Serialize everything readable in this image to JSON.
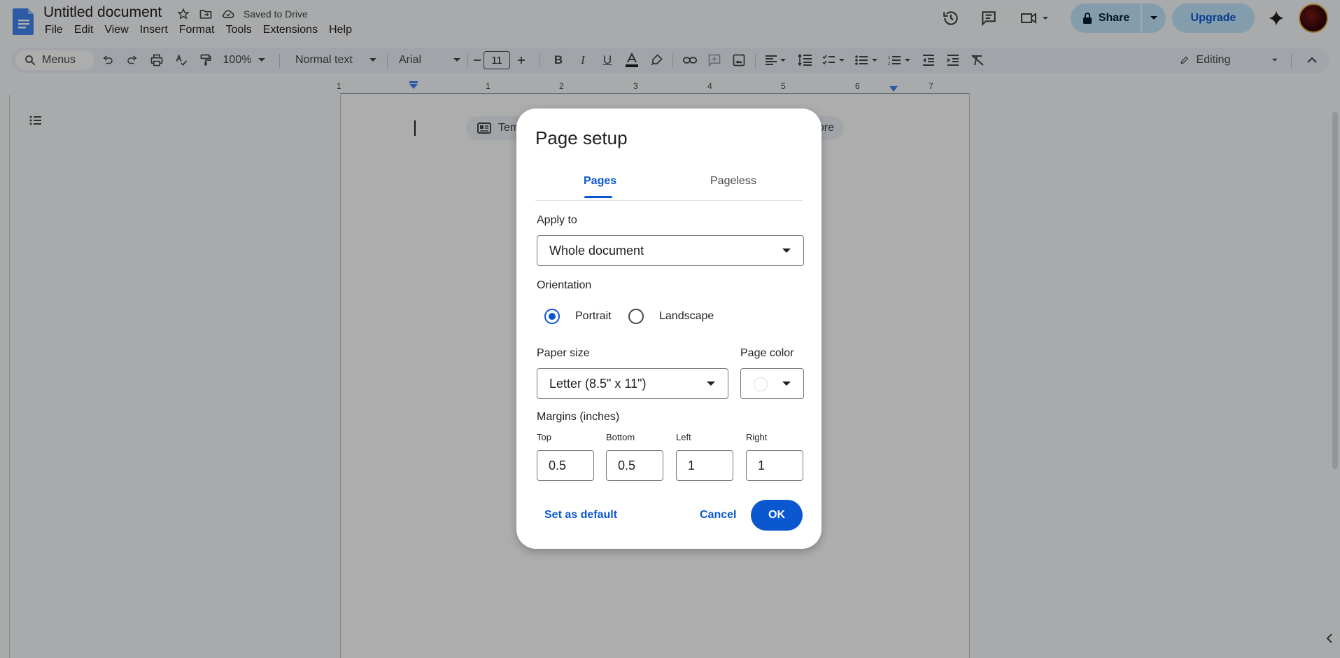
{
  "app": {
    "doc_title": "Untitled document",
    "save_status": "Saved to Drive",
    "menus": [
      "File",
      "Edit",
      "View",
      "Insert",
      "Format",
      "Tools",
      "Extensions",
      "Help"
    ],
    "share_label": "Share",
    "upgrade_label": "Upgrade"
  },
  "toolbar": {
    "search_label": "Menus",
    "zoom": "100%",
    "style": "Normal text",
    "font": "Arial",
    "font_size": "11",
    "mode": "Editing"
  },
  "ruler": {
    "numbers": [
      "1",
      "1",
      "2",
      "3",
      "4",
      "5",
      "6",
      "7"
    ]
  },
  "document": {
    "chip_left_text": "Tem",
    "chip_right_text": "ore"
  },
  "dialog": {
    "title": "Page setup",
    "tabs": [
      {
        "label": "Pages",
        "selected": true
      },
      {
        "label": "Pageless",
        "selected": false
      }
    ],
    "apply_to": {
      "label": "Apply to",
      "value": "Whole document"
    },
    "orientation": {
      "label": "Orientation",
      "options": [
        {
          "label": "Portrait",
          "checked": true
        },
        {
          "label": "Landscape",
          "checked": false
        }
      ]
    },
    "paper_size": {
      "label": "Paper size",
      "value": "Letter (8.5\" x 11\")"
    },
    "page_color": {
      "label": "Page color",
      "value": "#ffffff"
    },
    "margins": {
      "label": "Margins (inches)",
      "top": {
        "label": "Top",
        "value": "0.5"
      },
      "bottom": {
        "label": "Bottom",
        "value": "0.5"
      },
      "left": {
        "label": "Left",
        "value": "1"
      },
      "right": {
        "label": "Right",
        "value": "1"
      }
    },
    "buttons": {
      "set_default": "Set as default",
      "cancel": "Cancel",
      "ok": "OK"
    }
  },
  "colors": {
    "accent": "#0b57d0",
    "share_bg": "#c2e7ff",
    "toolbar_bg": "#edf2fa"
  }
}
